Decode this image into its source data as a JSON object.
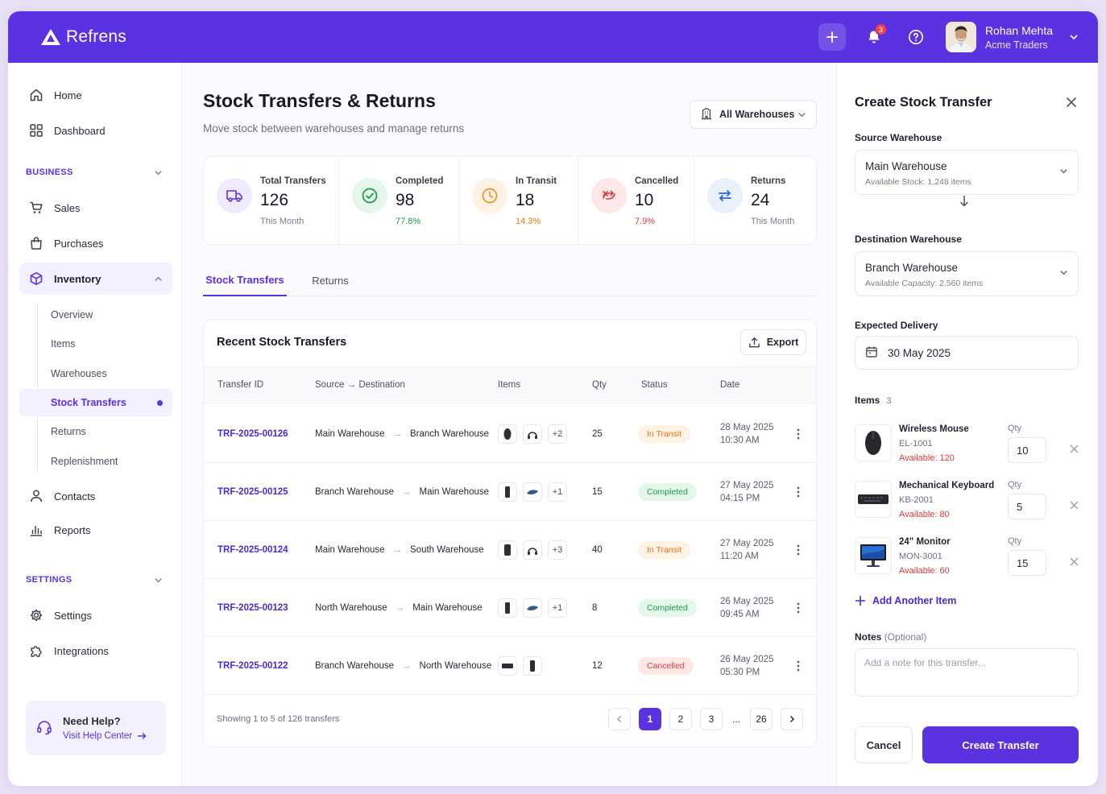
{
  "app": {
    "name": "Refrens"
  },
  "topbar": {
    "notification_count": "3"
  },
  "user": {
    "name": "Rohan Mehta",
    "org": "Acme Traders"
  },
  "sidebar": {
    "home": "Home",
    "dashboard": "Dashboard",
    "business_section": "BUSINESS",
    "sales": "Sales",
    "purchases": "Purchases",
    "inventory": "Inventory",
    "inventory_sub": [
      "Overview",
      "Items",
      "Warehouses",
      "Stock Transfers",
      "Returns",
      "Replenishment"
    ],
    "contacts": "Contacts",
    "reports": "Reports",
    "settings_section": "SETTINGS",
    "settings": "Settings",
    "integrations": "Integrations",
    "help_title": "Need Help?",
    "help_link": "Visit Help Center"
  },
  "page": {
    "title": "Stock Transfers & Returns",
    "subtitle": "Move stock between warehouses and manage returns",
    "warehouse_filter": "All Warehouses"
  },
  "stats": [
    {
      "title": "Total Transfers",
      "value": "126",
      "sub": "This Month"
    },
    {
      "title": "Completed",
      "value": "98",
      "sub": "77.8%"
    },
    {
      "title": "In Transit",
      "value": "18",
      "sub": "14.3%"
    },
    {
      "title": "Cancelled",
      "value": "10",
      "sub": "7.9%"
    },
    {
      "title": "Returns",
      "value": "24",
      "sub": "This Month"
    }
  ],
  "tabs": [
    "Stock Transfers",
    "Returns"
  ],
  "table": {
    "title": "Recent Stock Transfers",
    "export_label": "Export",
    "headers": [
      "Transfer ID",
      "Source → Destination",
      "Items",
      "Qty",
      "Status",
      "Date"
    ],
    "rows": [
      {
        "id": "TRF-2025-00126",
        "source": "Main Warehouse",
        "dest": "Branch Warehouse",
        "more": "+2",
        "qty": "25",
        "status": "In Transit",
        "date": "28 May 2025",
        "time": "10:30 AM"
      },
      {
        "id": "TRF-2025-00125",
        "source": "Branch Warehouse",
        "dest": "Main Warehouse",
        "more": "+1",
        "qty": "15",
        "status": "Completed",
        "date": "27 May 2025",
        "time": "04:15 PM"
      },
      {
        "id": "TRF-2025-00124",
        "source": "Main Warehouse",
        "dest": "South Warehouse",
        "more": "+3",
        "qty": "40",
        "status": "In Transit",
        "date": "27 May 2025",
        "time": "11:20 AM"
      },
      {
        "id": "TRF-2025-00123",
        "source": "North Warehouse",
        "dest": "Main Warehouse",
        "more": "+1",
        "qty": "8",
        "status": "Completed",
        "date": "26 May 2025",
        "time": "09:45 AM"
      },
      {
        "id": "TRF-2025-00122",
        "source": "Branch Warehouse",
        "dest": "North Warehouse",
        "more": "",
        "qty": "12",
        "status": "Cancelled",
        "date": "26 May 2025",
        "time": "05:30 PM"
      }
    ],
    "showing": "Showing 1 to 5 of 126 transfers",
    "pages": [
      "1",
      "2",
      "3",
      "...",
      "26"
    ]
  },
  "panel": {
    "title": "Create Stock Transfer",
    "source_label": "Source Warehouse",
    "source_value": "Main Warehouse",
    "source_sub": "Available Stock: 1,248 items",
    "dest_label": "Destination Warehouse",
    "dest_value": "Branch Warehouse",
    "dest_sub": "Available Capacity: 2,560 items",
    "delivery_label": "Expected Delivery",
    "delivery_value": "30 May 2025",
    "items_label": "Items",
    "items_count": "3",
    "items": [
      {
        "name": "Wireless Mouse",
        "sku": "EL-1001",
        "available": "Available: 120",
        "qty_label": "Qty",
        "qty": "10"
      },
      {
        "name": "Mechanical Keyboard",
        "sku": "KB-2001",
        "available": "Available: 80",
        "qty_label": "Qty",
        "qty": "5"
      },
      {
        "name": "24\" Monitor",
        "sku": "MON-3001",
        "available": "Available: 60",
        "qty_label": "Qty",
        "qty": "15"
      }
    ],
    "add_item": "Add Another Item",
    "notes_label": "Notes",
    "notes_optional": "(Optional)",
    "notes_placeholder": "Add a note for this transfer...",
    "cancel": "Cancel",
    "create": "Create Transfer"
  },
  "colors": {
    "brand": "#5a32e0",
    "transit": "#e27a13",
    "completed": "#1f9a4a",
    "cancelled": "#dc3b3b"
  }
}
